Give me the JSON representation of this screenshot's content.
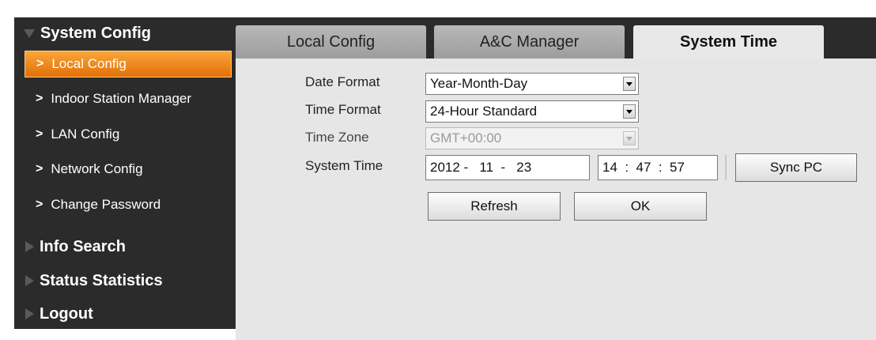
{
  "sidebar": {
    "system_config": "System Config",
    "items": [
      {
        "label": "Local Config"
      },
      {
        "label": "Indoor Station Manager"
      },
      {
        "label": "LAN Config"
      },
      {
        "label": "Network Config"
      },
      {
        "label": "Change Password"
      }
    ],
    "info_search": "Info Search",
    "status_statistics": "Status Statistics",
    "logout": "Logout",
    "chevron": ">"
  },
  "tabs": [
    {
      "label": "Local Config"
    },
    {
      "label": "A&C Manager"
    },
    {
      "label": "System Time"
    }
  ],
  "form": {
    "date_format_label": "Date Format",
    "date_format_value": "Year-Month-Day",
    "time_format_label": "Time Format",
    "time_format_value": "24-Hour Standard",
    "time_zone_label": "Time Zone",
    "time_zone_value": "GMT+00:00",
    "system_time_label": "System Time",
    "date_value": "2012 -   11  -   23",
    "time_value": "14  :  47  :  57",
    "sync_pc": "Sync PC",
    "refresh": "Refresh",
    "ok": "OK"
  },
  "colors": {
    "accent": "#f08a1c",
    "sidebar_bg": "#2b2b2b",
    "panel_bg": "#e6e6e6"
  }
}
